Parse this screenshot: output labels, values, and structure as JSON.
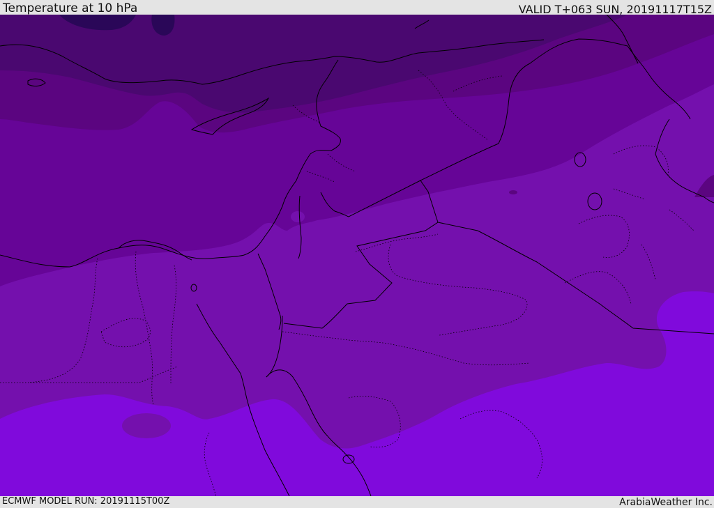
{
  "header": {
    "title": "Temperature at 10 hPa",
    "valid": "VALID T+063 SUN, 20191117T15Z"
  },
  "footer": {
    "model_run": "ECMWF MODEL RUN: 20191115T00Z",
    "credit": "ArabiaWeather Inc."
  },
  "map": {
    "field": "temperature",
    "colors": {
      "band_coldest": "#2a0758",
      "band_very_cold": "#4a0870",
      "band_cold": "#5b0580",
      "band_mid": "#660597",
      "band_mild": "#7410ad",
      "band_warm": "#800adc",
      "borders": "#000000"
    }
  }
}
